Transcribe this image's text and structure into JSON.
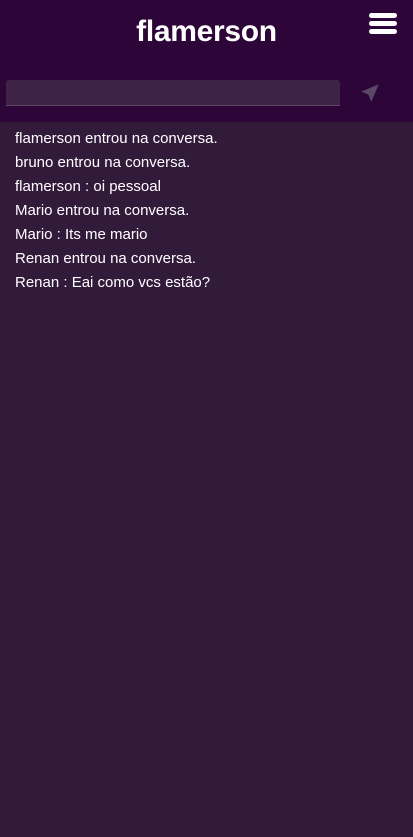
{
  "header": {
    "title": "flamerson",
    "menu_icon": "hamburger-menu-icon"
  },
  "composer": {
    "input_value": "",
    "input_placeholder": "",
    "send_icon": "paper-plane-send-icon"
  },
  "colors": {
    "header_background": "#2e0538",
    "chat_background": "#321a3b",
    "input_background": "#3d2346",
    "text": "#ffffff",
    "send_icon": "#5a4766"
  },
  "messages": [
    "flamerson entrou na conversa.",
    "bruno entrou na conversa.",
    "flamerson : oi pessoal",
    "Mario entrou na conversa.",
    "Mario : Its me mario",
    "Renan entrou na conversa.",
    "Renan : Eai como vcs estão?"
  ]
}
